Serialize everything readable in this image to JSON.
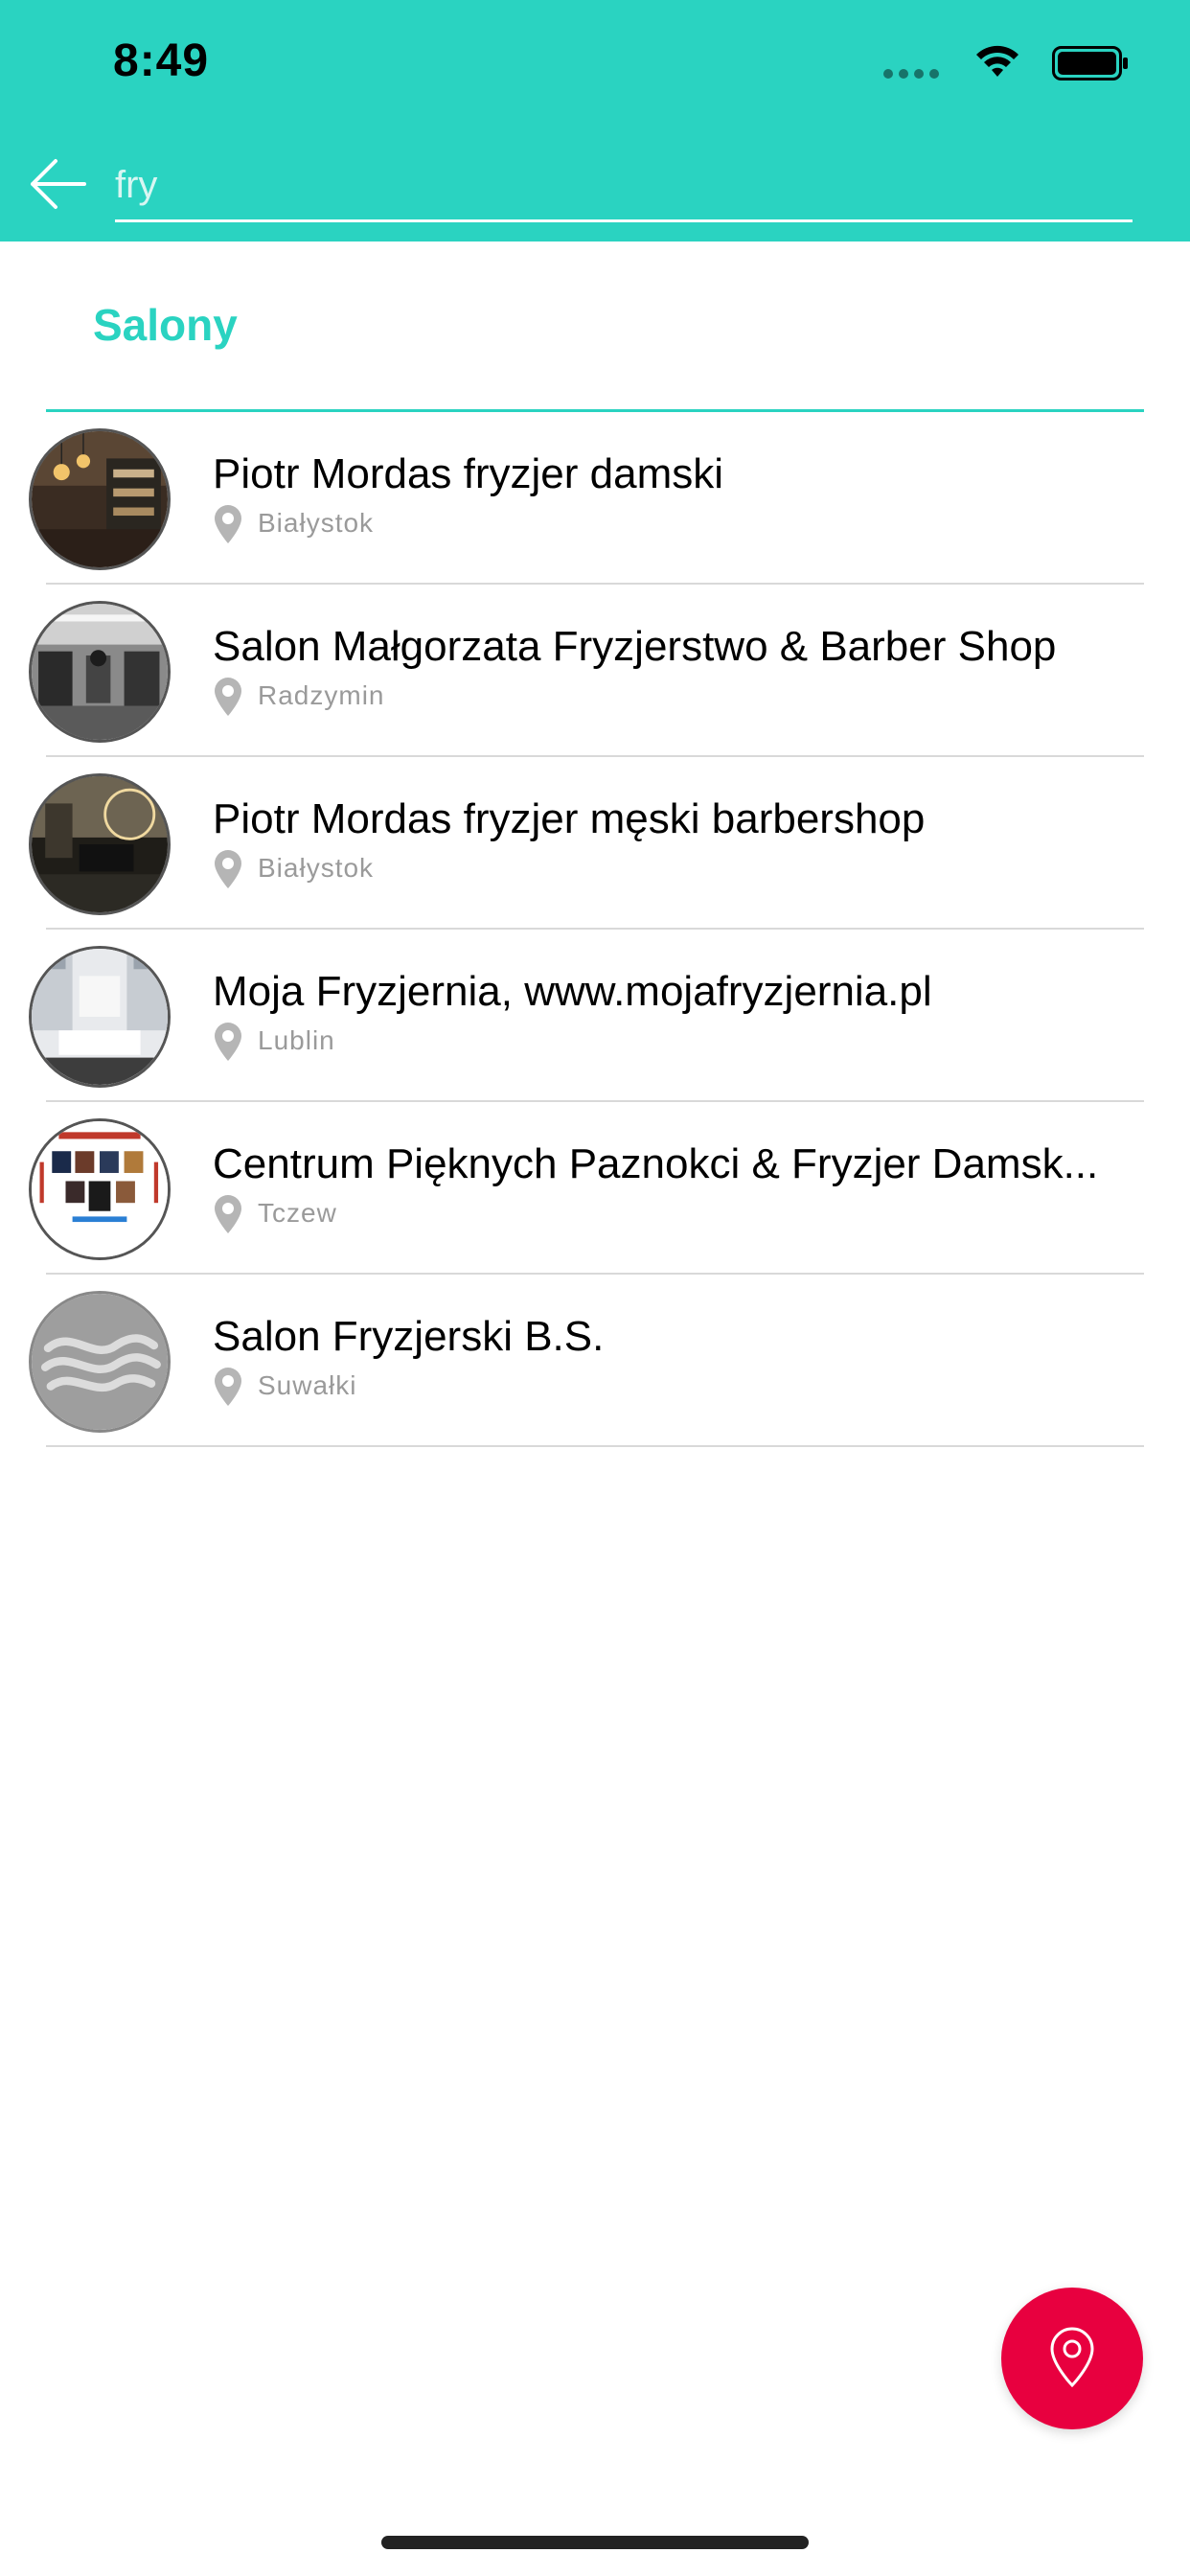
{
  "status_bar": {
    "time": "8:49"
  },
  "search": {
    "value": "fry",
    "placeholder": ""
  },
  "section": {
    "title": "Salony"
  },
  "colors": {
    "accent": "#2ad3c1",
    "fab": "#e8003f",
    "city_text": "#9a9a9a"
  },
  "salons": [
    {
      "name": "Piotr Mordas fryzjer damski",
      "city": "Białystok",
      "avatar": "salon-interior-warm"
    },
    {
      "name": "Salon Małgorzata Fryzjerstwo & Barber Shop",
      "city": "Radzymin",
      "avatar": "salon-interior-bw"
    },
    {
      "name": "Piotr Mordas fryzjer męski barbershop",
      "city": "Białystok",
      "avatar": "barbershop-interior-dark"
    },
    {
      "name": "Moja Fryzjernia, www.mojafryzjernia.pl",
      "city": "Lublin",
      "avatar": "salon-interior-white"
    },
    {
      "name": "Centrum Pięknych Paznokci & Fryzjer Damsk...",
      "city": "Tczew",
      "avatar": "flyer-collage"
    },
    {
      "name": "Salon Fryzjerski B.S.",
      "city": "Suwałki",
      "avatar": "default-wave-logo"
    }
  ],
  "fab": {
    "icon": "location-pin-icon"
  }
}
